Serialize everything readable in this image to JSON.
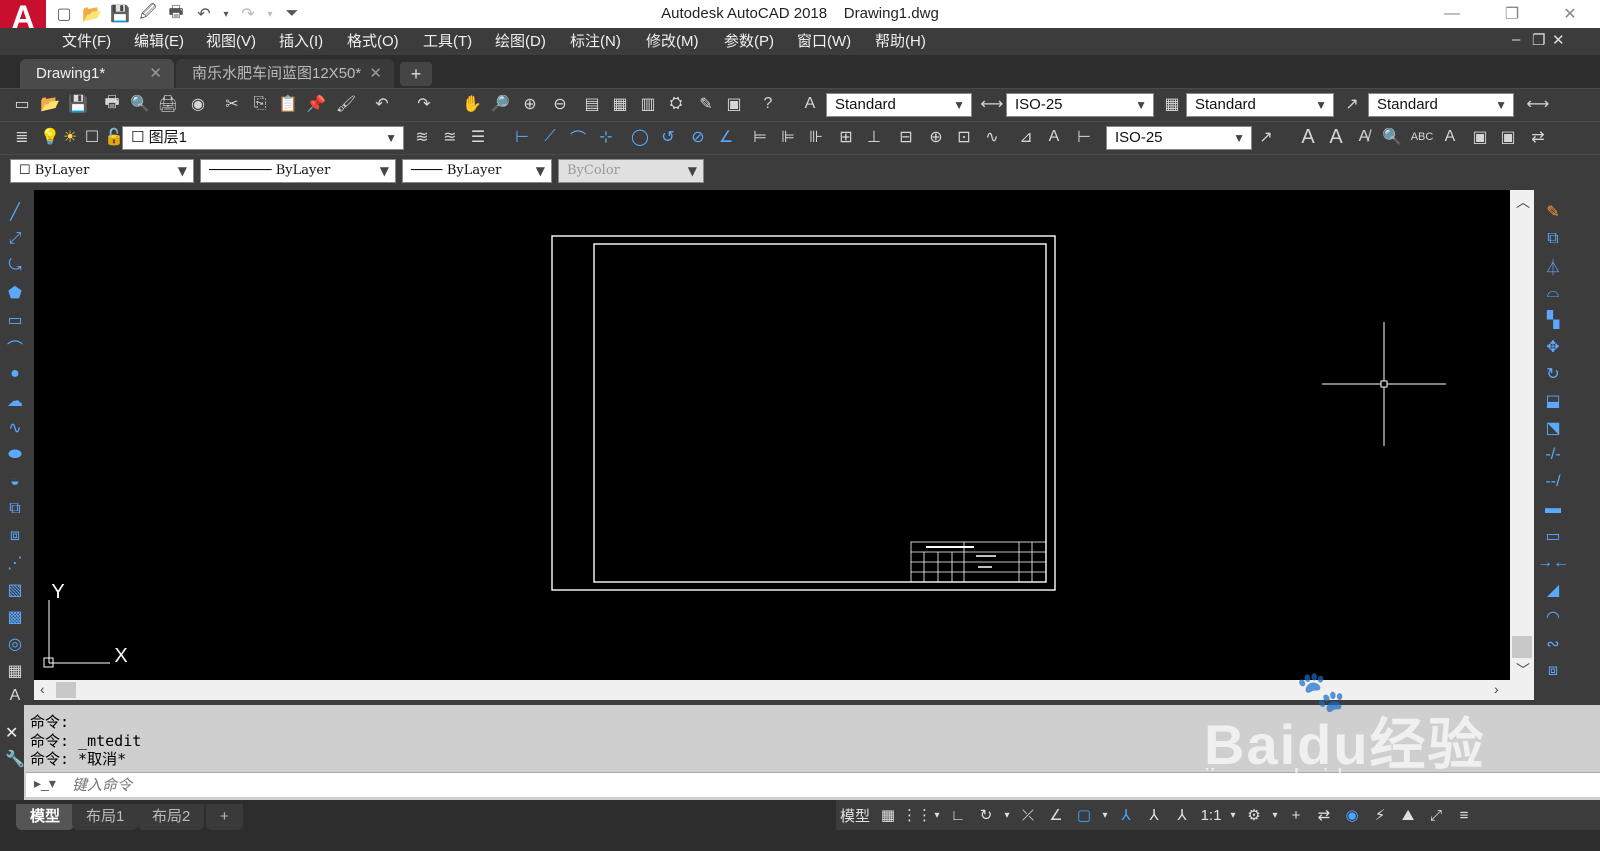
{
  "app": {
    "title": "Autodesk AutoCAD 2018    Drawing1.dwg",
    "logo": "A"
  },
  "menus": [
    {
      "label": "文件(F)"
    },
    {
      "label": "编辑(E)"
    },
    {
      "label": "视图(V)"
    },
    {
      "label": "插入(I)"
    },
    {
      "label": "格式(O)"
    },
    {
      "label": "工具(T)"
    },
    {
      "label": "绘图(D)"
    },
    {
      "label": "标注(N)"
    },
    {
      "label": "修改(M)"
    },
    {
      "label": "参数(P)"
    },
    {
      "label": "窗口(W)"
    },
    {
      "label": "帮助(H)"
    }
  ],
  "tabs": [
    {
      "label": "Drawing1*"
    },
    {
      "label": "南乐水肥车间蓝图12X50*"
    }
  ],
  "styles_toolbar": {
    "text_style": "Standard",
    "dim_style": "ISO-25",
    "table_style": "Standard",
    "multileader_style": "Standard"
  },
  "layers_toolbar": {
    "current_layer": "图层1",
    "dim_style_2": "ISO-25"
  },
  "properties_toolbar": {
    "color": "ByLayer",
    "linetype": "ByLayer",
    "lineweight": "ByLayer",
    "plot_style": "ByColor"
  },
  "ucs": {
    "x_label": "X",
    "y_label": "Y"
  },
  "command": {
    "history": [
      "命令:",
      "命令: _mtedit",
      "命令: *取消*"
    ],
    "placeholder": "键入命令"
  },
  "layout_tabs": [
    {
      "label": "模型",
      "active": true
    },
    {
      "label": "布局1",
      "active": false
    },
    {
      "label": "布局2",
      "active": false
    }
  ],
  "status": {
    "model_label": "模型",
    "scale": "1:1"
  },
  "watermark": {
    "brand": "Baidu经验",
    "url": "jingyan.baidu.com"
  }
}
